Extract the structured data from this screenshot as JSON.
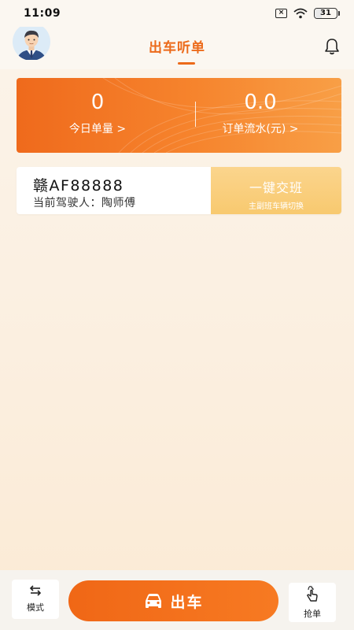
{
  "status_bar": {
    "time": "11:09",
    "sim_label": "×",
    "battery": "31",
    "battery_level": 0.31,
    "icons": [
      "sim-off-icon",
      "wifi-icon",
      "battery-icon"
    ]
  },
  "header": {
    "title": "出车听单",
    "avatar_icon": "driver-avatar-icon",
    "bell_icon": "bell-icon"
  },
  "stats": {
    "orders_today_value": "0",
    "orders_today_label": "今日单量 >",
    "revenue_value": "0.0",
    "revenue_label": "订单流水(元) >"
  },
  "vehicle": {
    "plate": "赣AF88888",
    "driver_line": "当前驾驶人：陶师傅",
    "shift_button": "一键交班",
    "shift_sub": "主副班车辆切换"
  },
  "bottom": {
    "mode_label": "模式",
    "depart_label": "出车",
    "grab_label": "抢单",
    "mode_icon": "swap-arrows-icon",
    "depart_icon": "car-icon",
    "grab_icon": "hand-tap-icon"
  },
  "colors": {
    "accent": "#ec6a1a",
    "card_gradient_start": "#ef6a1c",
    "card_gradient_end": "#f89f46",
    "shift_button": "#f8c96f",
    "page_bg": "#fbf4ea"
  }
}
